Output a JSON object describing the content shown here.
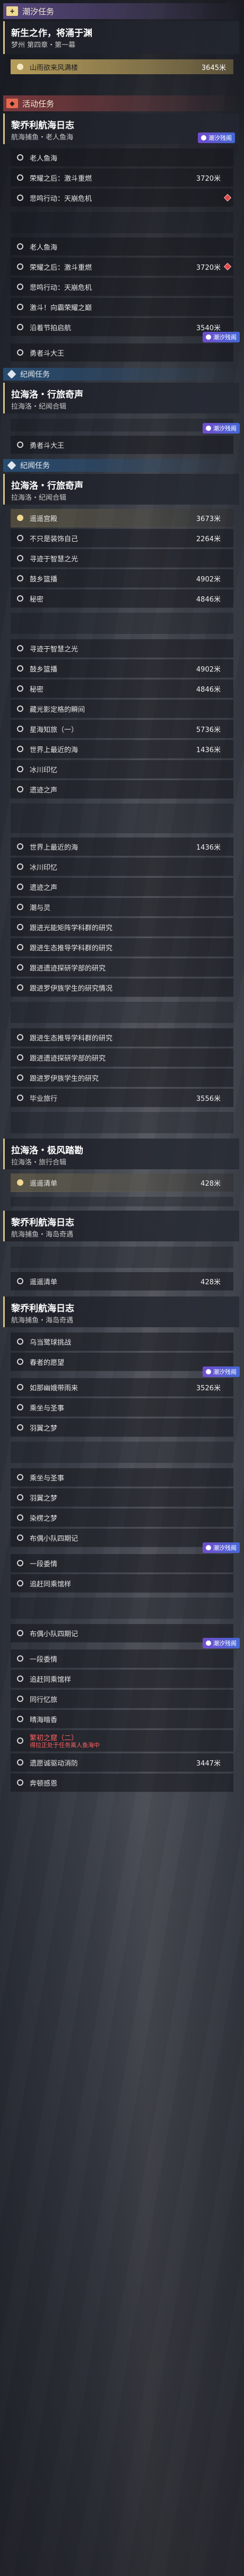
{
  "sections": {
    "seasonal": {
      "title": "潮汐任务"
    },
    "event": {
      "title": "活动任务"
    },
    "beacon1": {
      "title": "纪闻任务"
    },
    "beacon2": {
      "title": "纪闻任务"
    }
  },
  "card_main": {
    "title": "新生之作，将涌于渊",
    "sub": "梦州 第四章・第一幕"
  },
  "reward_row": {
    "label": "山雨欲来风满楼",
    "dist": "3645米"
  },
  "card_fisher": {
    "title": "黎乔利航海日志",
    "sub": "航海捕鱼・老人鱼海"
  },
  "card_lahailuo_1": {
    "title": "拉海洛・行旅奇声",
    "sub": "拉海洛・纪闻合辑"
  },
  "card_lahailuo_2": {
    "title": "拉海洛・行旅奇声",
    "sub": "拉海洛・纪闻合辑"
  },
  "card_lahailuo_3": {
    "title": "拉海洛・极风踏勘",
    "sub": "拉海洛・旅行合辑"
  },
  "card_fisher_2": {
    "title": "黎乔利航海日志",
    "sub": "航海捕鱼・海岛奇遇"
  },
  "card_fisher_3": {
    "title": "黎乔利航海日志",
    "sub": "航海捕鱼・海岛奇遇"
  },
  "badge_label": "潮汐残阁",
  "steps_a": [
    {
      "label": "老人鱼海",
      "dist": ""
    },
    {
      "label": "荣耀之后：激斗重燃",
      "dist": "3720米"
    },
    {
      "label": "悲鸣行动：天崩危机",
      "dist": ""
    }
  ],
  "steps_b": [
    {
      "label": "老人鱼海",
      "dist": ""
    },
    {
      "label": "荣耀之后：激斗重燃",
      "dist": "3720米"
    },
    {
      "label": "悲鸣行动：天崩危机",
      "dist": ""
    },
    {
      "label": "激斗！向霸荣耀之巅",
      "dist": ""
    },
    {
      "label": "沿着节拍启航",
      "dist": "3540米"
    },
    {
      "label": "勇者斗大王",
      "dist": ""
    }
  ],
  "step_c": {
    "label": "勇者斗大王"
  },
  "steps_d": [
    {
      "label": "遥遥宫殿",
      "dist": "3673米"
    },
    {
      "label": "不只是装饰自己",
      "dist": "2264米"
    },
    {
      "label": "寻迹于智慧之光",
      "dist": ""
    },
    {
      "label": "鼓乡篮播",
      "dist": "4902米"
    },
    {
      "label": "秘密",
      "dist": "4846米"
    }
  ],
  "steps_e": [
    {
      "label": "寻迹于智慧之光",
      "dist": ""
    },
    {
      "label": "鼓乡篮播",
      "dist": "4902米"
    },
    {
      "label": "秘密",
      "dist": "4846米"
    },
    {
      "label": "藏光影定格的瞬间",
      "dist": ""
    },
    {
      "label": "星海知旅（一）",
      "dist": "5736米"
    },
    {
      "label": "世界上最近的海",
      "dist": "1436米"
    },
    {
      "label": "冰川印忆",
      "dist": ""
    },
    {
      "label": "遗迹之声",
      "dist": ""
    }
  ],
  "steps_f": [
    {
      "label": "世界上最近的海",
      "dist": "1436米"
    },
    {
      "label": "冰川印忆",
      "dist": ""
    },
    {
      "label": "遗迹之声",
      "dist": ""
    },
    {
      "label": "潮与灵",
      "dist": ""
    },
    {
      "label": "跟进光能矩阵学科群的研究",
      "dist": ""
    },
    {
      "label": "跟进生态推导学科群的研究",
      "dist": ""
    },
    {
      "label": "跟进遗迹探研学部的研究",
      "dist": ""
    },
    {
      "label": "跟进罗伊族学生的研究情况",
      "dist": ""
    }
  ],
  "steps_g": [
    {
      "label": "跟进生态推导学科群的研究",
      "dist": ""
    },
    {
      "label": "跟进遗迹探研学部的研究",
      "dist": ""
    },
    {
      "label": "跟进罗伊族学生的研究",
      "dist": ""
    },
    {
      "label": "毕业旅行",
      "dist": "3556米"
    }
  ],
  "step_h": {
    "label": "遥遥清单",
    "dist": "428米"
  },
  "step_i": {
    "label": "遥遥清单",
    "dist": "428米"
  },
  "steps_j": [
    {
      "label": "乌当鹭球挑战",
      "dist": ""
    },
    {
      "label": "春者的愿望",
      "dist": ""
    },
    {
      "label": "如那幽娥带雨来",
      "dist": "3526米"
    },
    {
      "label": "乘坐与圣事",
      "dist": ""
    },
    {
      "label": "羽翼之梦",
      "dist": ""
    }
  ],
  "steps_k": [
    {
      "label": "乘坐与圣事",
      "dist": ""
    },
    {
      "label": "羽翼之梦",
      "dist": ""
    },
    {
      "label": "染楞之梦",
      "dist": ""
    },
    {
      "label": "布偶小队四期记",
      "dist": ""
    },
    {
      "label": "一段委情",
      "dist": ""
    },
    {
      "label": "追赶同乘馆样",
      "dist": ""
    }
  ],
  "steps_l": [
    {
      "label": "布偶小队四期记",
      "dist": ""
    },
    {
      "label": "一段委情",
      "dist": ""
    },
    {
      "label": "追赶同乘馆样",
      "dist": ""
    },
    {
      "label": "同行忆旅",
      "dist": ""
    },
    {
      "label": "晴海暗香",
      "dist": ""
    }
  ],
  "step_warn": {
    "label": "繁初之窟（二）",
    "warn": "得拉正处于任务离人鱼海中"
  },
  "steps_m": [
    {
      "label": "遗愿诚驱动消防",
      "dist": "3447米"
    },
    {
      "label": "奔顿感恩",
      "dist": ""
    }
  ],
  "colors": {
    "gold": "#d8c08a",
    "blue": "#285078",
    "badge": "#7850dc",
    "warn": "#ff6060"
  }
}
